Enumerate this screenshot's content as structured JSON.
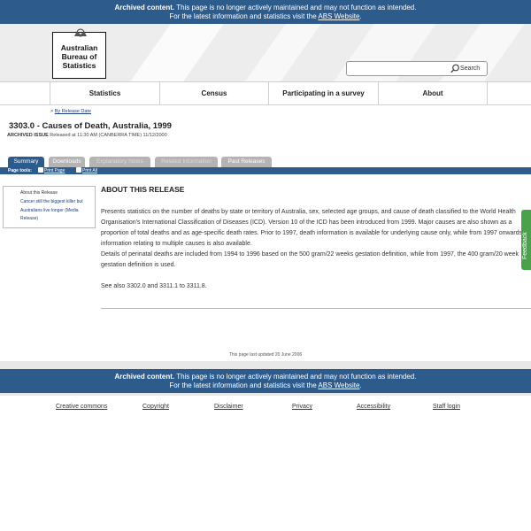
{
  "archive_banner": {
    "bold": "Archived content.",
    "text": " This page is no longer actively maintained and may not function as intended.",
    "line2_prefix": "For the latest information and statistics visit the ",
    "link": "ABS Website",
    "line2_suffix": "."
  },
  "logo": {
    "line1": "Australian",
    "line2": "Bureau of",
    "line3": "Statistics"
  },
  "search": {
    "placeholder": "",
    "button_label": "Search"
  },
  "nav": {
    "items": [
      "Statistics",
      "Census",
      "Participating in a survey",
      "About"
    ]
  },
  "breadcrumb": {
    "prefix": "> ",
    "link": "By Release Date"
  },
  "page": {
    "title": "3303.0 - Causes of Death, Australia, 1999",
    "archived_label": "ARCHIVED ISSUE",
    "archived_text": " Released at 11:30 AM (CANBERRA TIME) 11/12/2000"
  },
  "tabs": [
    {
      "label": "Summary",
      "state": "active"
    },
    {
      "label": "Downloads",
      "state": "normal"
    },
    {
      "label": "Explanatory Notes",
      "state": "disabled"
    },
    {
      "label": "Related Information",
      "state": "disabled"
    },
    {
      "label": "Past Releases",
      "state": "normal"
    }
  ],
  "toolbar": {
    "label": "Page tools:",
    "print_page": "Print Page",
    "print_all": "Print All"
  },
  "sidebar": {
    "heading": "About this Release",
    "link": "Cancer still the biggest killer but Australians live longer (Media Release)"
  },
  "main": {
    "heading": "ABOUT THIS RELEASE",
    "para1": "Presents statistics on the number of deaths by state or territory of Australia, sex, selected age groups, and cause of death classified to the World Health Organisation's International Classification of Diseases (ICD). Version 10 of the ICD has been introduced from 1999. Major causes are also shown as a proportion of total deaths and as age-specific death rates. Prior to 1997, death information is available for underlying cause only, while from 1997 onwards, information relating to multiple causes is also available.",
    "para2": "Details of perinatal deaths are included from 1994 to 1996 based on the 500 gram/22 weeks gestation definition, while from 1997, the 400 gram/20 week gestation definition is used.",
    "para3": "See also 3302.0 and 3311.1 to 3311.8."
  },
  "feedback": {
    "label": "Feedback"
  },
  "last_updated": "This page last updated 20 June 2006",
  "footer": {
    "links": [
      "Creative commons",
      "Copyright",
      "Disclaimer",
      "Privacy",
      "Accessibility",
      "Staff login"
    ]
  },
  "colors": {
    "brand_blue": "#2d5b8c",
    "feedback_green": "#4aa14a",
    "tab_grey": "#b4b4b4"
  }
}
